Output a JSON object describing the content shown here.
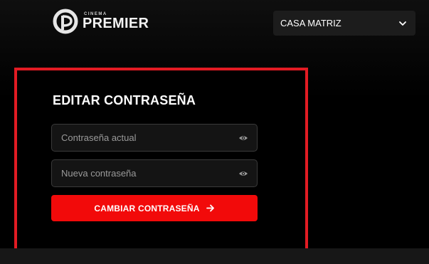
{
  "header": {
    "logo": {
      "small_text": "CINEMA",
      "brand_text": "PREMIER"
    },
    "branch_select": {
      "value": "CASA MATRIZ",
      "icon": "chevron-down-icon"
    }
  },
  "panel": {
    "title": "EDITAR CONTRASEÑA",
    "current_password": {
      "placeholder": "Contraseña actual",
      "value": "",
      "icon": "eye-icon"
    },
    "new_password": {
      "placeholder": "Nueva contraseña",
      "value": "",
      "icon": "eye-icon"
    },
    "submit": {
      "label": "CAMBIAR CONTRASEÑA",
      "icon": "arrow-right-icon"
    }
  },
  "colors": {
    "accent": "#f20a0a",
    "highlight_border": "#e21b23",
    "background": "#000000",
    "input_bg": "#141414",
    "select_bg": "#1c1c1c"
  }
}
